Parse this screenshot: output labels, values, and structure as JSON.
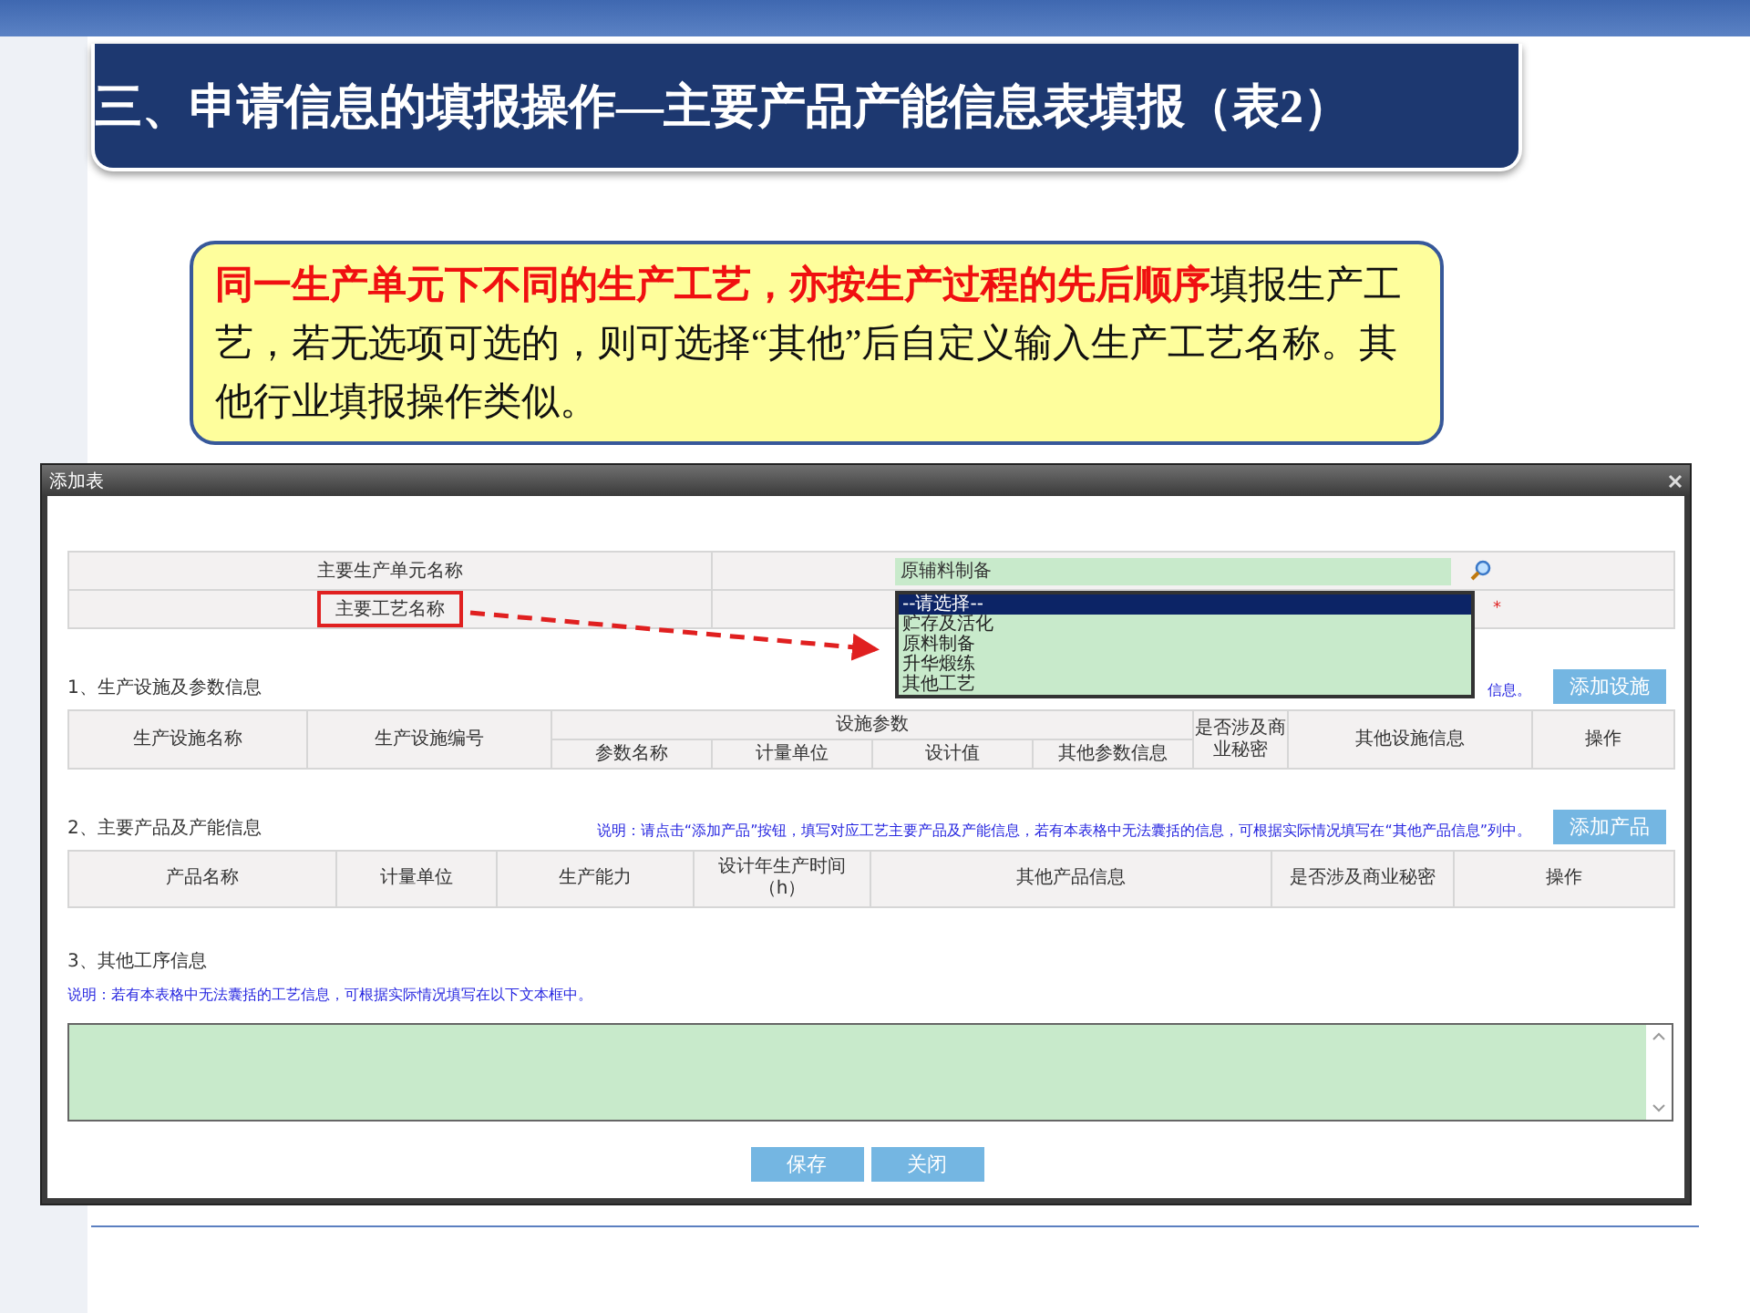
{
  "slide": {
    "title": "三、申请信息的填报操作—主要产品产能信息表填报（表2）",
    "callout": "**同一生产单元下不同的生产工艺，亦按生产过程的先后顺序**填报生产工艺，若无选项可选的，则可选择“其他”后自定义输入生产工艺名称。其他行业填报操作类似。"
  },
  "dialog": {
    "title": "添加表",
    "form_rows": [
      {
        "kind": "field",
        "label": "主要生产单元名称",
        "value": "原辅料制备",
        "highlighted": false
      },
      {
        "kind": "select",
        "label": "主要工艺名称",
        "highlighted": true,
        "required": "*"
      }
    ],
    "dropdown": {
      "options": [
        {
          "label": "--请选择--",
          "selected": true
        },
        {
          "label": "贮存及活化",
          "selected": false
        },
        {
          "label": "原料制备",
          "selected": false
        },
        {
          "label": "升华煅练",
          "selected": false
        },
        {
          "label": "其他工艺",
          "selected": false
        }
      ]
    },
    "sections": [
      {
        "kind": "table",
        "heading": "1、生产设施及参数信息",
        "note": "信息。",
        "button": "添加设施",
        "columns": [
          {
            "label": "生产设施名称"
          },
          {
            "label": "生产设施编号"
          },
          {
            "label": "设施参数",
            "children": [
              {
                "label": "参数名称"
              },
              {
                "label": "计量单位"
              },
              {
                "label": "设计值"
              },
              {
                "label": "其他参数信息"
              }
            ]
          },
          {
            "label": "是否涉及商业秘密"
          },
          {
            "label": "其他设施信息"
          },
          {
            "label": "操作"
          }
        ]
      },
      {
        "kind": "table",
        "heading": "2、主要产品及产能信息",
        "note": "说明：请点击“添加产品”按钮，填写对应工艺主要产品及产能信息，若有本表格中无法囊括的信息，可根据实际情况填写在“其他产品信息”列中。",
        "button": "添加产品",
        "columns": [
          {
            "label": "产品名称"
          },
          {
            "label": "计量单位"
          },
          {
            "label": "生产能力"
          },
          {
            "label": "设计年生产时间（h）"
          },
          {
            "label": "其他产品信息"
          },
          {
            "label": "是否涉及商业秘密"
          },
          {
            "label": "操作"
          }
        ]
      },
      {
        "kind": "text",
        "heading": "3、其他工序信息",
        "note": "说明：若有本表格中无法囊括的工艺信息，可根据实际情况填写在以下文本框中。"
      }
    ],
    "buttons": [
      "保存",
      "关闭"
    ]
  }
}
